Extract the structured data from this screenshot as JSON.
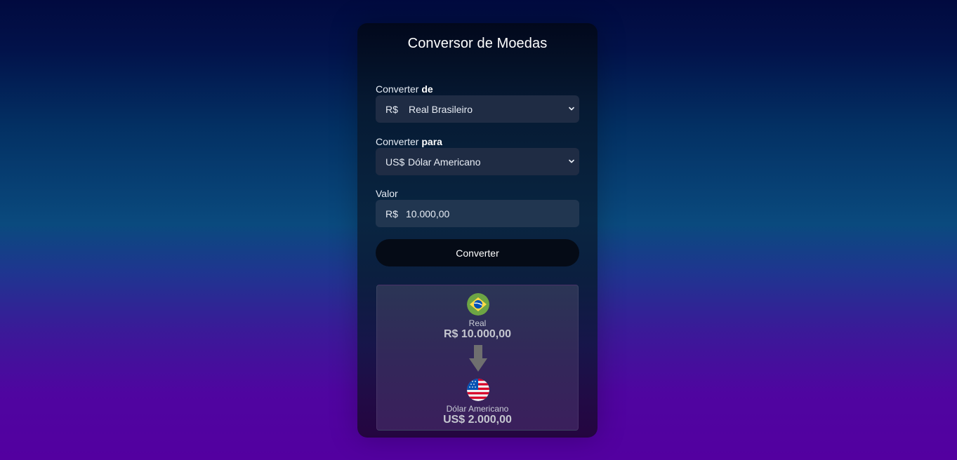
{
  "title": "Conversor de Moedas",
  "from": {
    "label_prefix": "Converter ",
    "label_strong": "de",
    "symbol": "R$",
    "currency": "Real Brasileiro"
  },
  "to": {
    "label_prefix": "Converter ",
    "label_strong": "para",
    "symbol": "US$",
    "currency": "Dólar Americano"
  },
  "amount": {
    "label": "Valor",
    "symbol": "R$",
    "value": "10.000,00"
  },
  "convert_button": "Converter",
  "result": {
    "source_name": "Real",
    "source_value": "R$ 10.000,00",
    "target_name": "Dólar Americano",
    "target_value": "US$ 2.000,00",
    "source_flag_icon": "brazil-flag-icon",
    "target_flag_icon": "usa-flag-icon",
    "arrow_icon": "arrow-down-icon",
    "arrow_color": "#6f6f6f"
  }
}
